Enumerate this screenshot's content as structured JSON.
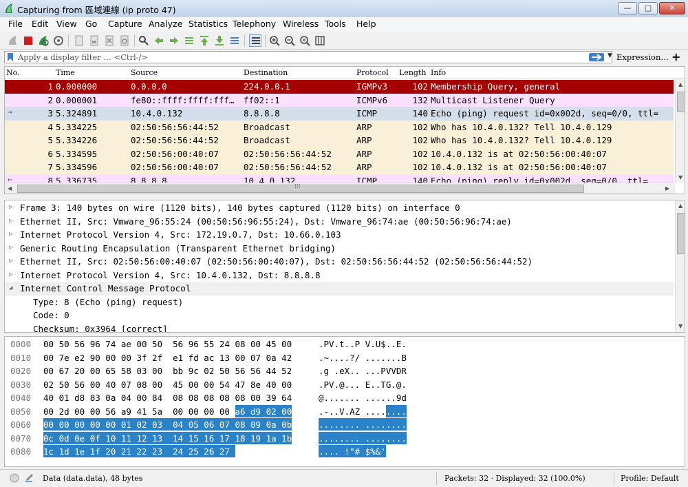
{
  "window": {
    "title": "Capturing from 區域連線 (ip proto 47)",
    "controls": {
      "minimize": "—",
      "maximize": "□",
      "close": "✕"
    }
  },
  "menu": [
    "File",
    "Edit",
    "View",
    "Go",
    "Capture",
    "Analyze",
    "Statistics",
    "Telephony",
    "Wireless",
    "Tools",
    "Help"
  ],
  "filter": {
    "placeholder": "Apply a display filter … <Ctrl-/>",
    "expression_label": "Expression…",
    "add_label": "+"
  },
  "packet_list": {
    "columns": [
      "No.",
      "Time",
      "Source",
      "Destination",
      "Protocol",
      "Length",
      "Info"
    ],
    "rows": [
      {
        "no": "1",
        "time": "0.000000",
        "src": "0.0.0.0",
        "dst": "224.0.0.1",
        "proto": "IGMPv3",
        "len": "102",
        "info": "Membership Query, general",
        "bg": "#a40000",
        "fg": "#ffffff",
        "arrow": ""
      },
      {
        "no": "2",
        "time": "0.000001",
        "src": "fe80::ffff:ffff:fff…",
        "dst": "ff02::1",
        "proto": "ICMPv6",
        "len": "132",
        "info": "Multicast Listener Query",
        "bg": "#fce0ff",
        "fg": "#000000",
        "arrow": ""
      },
      {
        "no": "3",
        "time": "5.324891",
        "src": "10.4.0.132",
        "dst": "8.8.8.8",
        "proto": "ICMP",
        "len": "140",
        "info": "Echo (ping) request  id=0x002d, seq=0/0, ttl=",
        "bg": "#d4ddea",
        "fg": "#000000",
        "arrow": "→"
      },
      {
        "no": "4",
        "time": "5.334225",
        "src": "02:50:56:56:44:52",
        "dst": "Broadcast",
        "proto": "ARP",
        "len": "102",
        "info": "Who has 10.4.0.132? Tell 10.4.0.129",
        "bg": "#faf0d7",
        "fg": "#000000",
        "arrow": ""
      },
      {
        "no": "5",
        "time": "5.334226",
        "src": "02:50:56:56:44:52",
        "dst": "Broadcast",
        "proto": "ARP",
        "len": "102",
        "info": "Who has 10.4.0.132? Tell 10.4.0.129",
        "bg": "#faf0d7",
        "fg": "#000000",
        "arrow": ""
      },
      {
        "no": "6",
        "time": "5.334595",
        "src": "02:50:56:00:40:07",
        "dst": "02:50:56:56:44:52",
        "proto": "ARP",
        "len": "102",
        "info": "10.4.0.132 is at 02:50:56:00:40:07",
        "bg": "#faf0d7",
        "fg": "#000000",
        "arrow": ""
      },
      {
        "no": "7",
        "time": "5.334596",
        "src": "02:50:56:00:40:07",
        "dst": "02:50:56:56:44:52",
        "proto": "ARP",
        "len": "102",
        "info": "10.4.0.132 is at 02:50:56:00:40:07",
        "bg": "#faf0d7",
        "fg": "#000000",
        "arrow": ""
      },
      {
        "no": "8",
        "time": "5.336735",
        "src": "8.8.8.8",
        "dst": "10.4.0.132",
        "proto": "ICMP",
        "len": "140",
        "info": "Echo (ping) reply    id=0x002d, seq=0/0, ttl=",
        "bg": "#fce0ff",
        "fg": "#000000",
        "arrow": "←"
      }
    ],
    "hscroll_grip": "⁞⁞⁞"
  },
  "details": {
    "rows": [
      {
        "text": "Frame 3: 140 bytes on wire (1120 bits), 140 bytes captured (1120 bits) on interface 0",
        "tri": "▷",
        "child": false,
        "expanded": false
      },
      {
        "text": "Ethernet II, Src: Vmware_96:55:24 (00:50:56:96:55:24), Dst: Vmware_96:74:ae (00:50:56:96:74:ae)",
        "tri": "▷",
        "child": false,
        "expanded": false
      },
      {
        "text": "Internet Protocol Version 4, Src: 172.19.0.7, Dst: 10.66.0.103",
        "tri": "▷",
        "child": false,
        "expanded": false
      },
      {
        "text": "Generic Routing Encapsulation (Transparent Ethernet bridging)",
        "tri": "▷",
        "child": false,
        "expanded": false
      },
      {
        "text": "Ethernet II, Src: 02:50:56:00:40:07 (02:50:56:00:40:07), Dst: 02:50:56:56:44:52 (02:50:56:56:44:52)",
        "tri": "▷",
        "child": false,
        "expanded": false
      },
      {
        "text": "Internet Protocol Version 4, Src: 10.4.0.132, Dst: 8.8.8.8",
        "tri": "▷",
        "child": false,
        "expanded": false
      },
      {
        "text": "Internet Control Message Protocol",
        "tri": "◢",
        "child": false,
        "expanded": true
      },
      {
        "text": "Type: 8 (Echo (ping) request)",
        "tri": "",
        "child": true,
        "expanded": false
      },
      {
        "text": "Code: 0",
        "tri": "",
        "child": true,
        "expanded": false
      },
      {
        "text": "Checksum: 0x3964 [correct]",
        "tri": "",
        "child": true,
        "expanded": false
      }
    ]
  },
  "bytes": {
    "lines": [
      {
        "offset": "0000",
        "hex": "00 50 56 96 74 ae 00 50  56 96 55 24 08 00 45 00",
        "ascii": ".PV.t..P V.U$..E."
      },
      {
        "offset": "0010",
        "hex": "00 7e e2 90 00 00 3f 2f  e1 fd ac 13 00 07 0a 42",
        "ascii": ".~....?/ .......B"
      },
      {
        "offset": "0020",
        "hex": "00 67 20 00 65 58 03 00  bb 9c 02 50 56 56 44 52",
        "ascii": ".g .eX.. ...PVVDR"
      },
      {
        "offset": "0030",
        "hex": "02 50 56 00 40 07 08 00  45 00 00 54 47 8e 40 00",
        "ascii": ".PV.@... E..TG.@."
      },
      {
        "offset": "0040",
        "hex": "40 01 d8 83 0a 04 00 84  08 08 08 08 08 00 39 64",
        "ascii": "@....... ......9d"
      },
      {
        "offset": "0050",
        "hex": "00 2d 00 00 56 a9 41 5a  00 00 00 00 a6 d9 02 00",
        "ascii": ".-..V.AZ ........"
      },
      {
        "offset": "0060",
        "hex": "00 00 00 00 00 01 02 03  04 05 06 07 08 09 0a 0b",
        "ascii": "........ ........"
      },
      {
        "offset": "0070",
        "hex": "0c 0d 0e 0f 10 11 12 13  14 15 16 17 18 19 1a 1b",
        "ascii": "........ ........"
      },
      {
        "offset": "0080",
        "hex": "1c 1d 1e 1f 20 21 22 23  24 25 26 27",
        "ascii": ".... !\"# $%&'"
      }
    ]
  },
  "status": {
    "field": "Data (data.data), 48 bytes",
    "packets": "Packets: 32 · Displayed: 32 (100.0%)",
    "profile": "Profile: Default"
  },
  "colors": {
    "selection": "#2a83c9",
    "accent": "#3d7fd0"
  }
}
